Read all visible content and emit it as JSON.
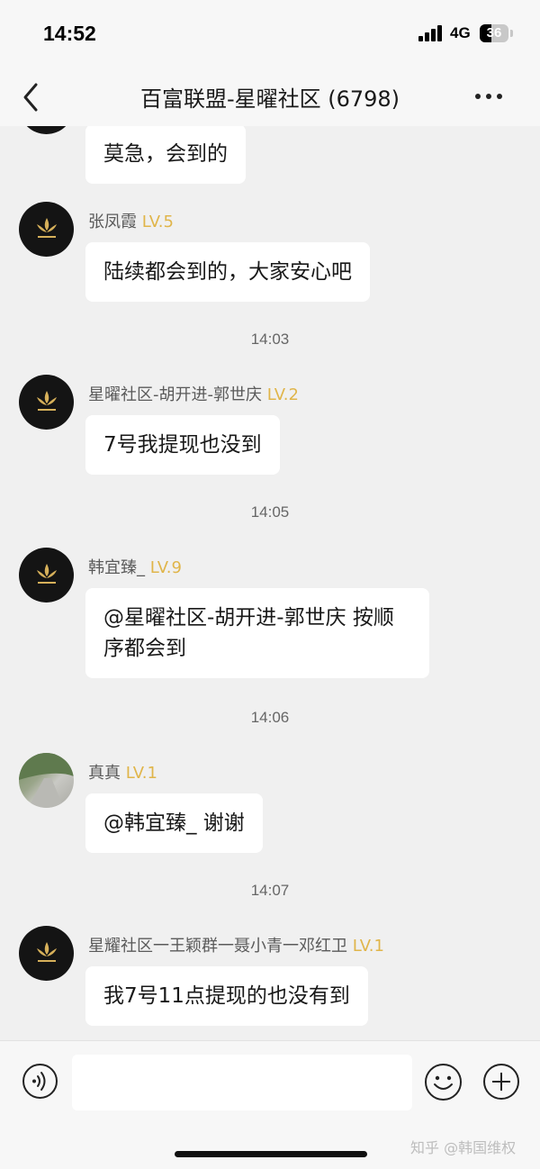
{
  "status_bar": {
    "time": "14:52",
    "network": "4G",
    "battery": "36"
  },
  "nav": {
    "title": "百富联盟-星曜社区 (6798)"
  },
  "messages": [
    {
      "text": "莫急，会到的"
    },
    {
      "sender": "张凤霞",
      "level": "LV.5",
      "text": "陆续都会到的，大家安心吧"
    },
    {
      "sender": "星曜社区-胡开进-郭世庆",
      "level": "LV.2",
      "text": "7号我提现也没到"
    },
    {
      "sender": "韩宜臻_",
      "level": "LV.9",
      "text": "@星曜社区-胡开进-郭世庆 按顺序都会到"
    },
    {
      "sender": "真真",
      "level": "LV.1",
      "text": "@韩宜臻_ 谢谢"
    },
    {
      "sender": "星耀社区一王颖群一聂小青一邓红卫",
      "level": "LV.1",
      "text": "我7号11点提现的也没有到"
    }
  ],
  "timestamps": [
    "14:03",
    "14:05",
    "14:06",
    "14:07"
  ],
  "avatar_logo_text": "星曜社区",
  "input": {
    "placeholder": ""
  },
  "watermark": "知乎 @韩国维权",
  "colors": {
    "level": "#e0b54a",
    "background": "#f0f0f0",
    "bubble": "#ffffff",
    "avatar": "#141414"
  }
}
